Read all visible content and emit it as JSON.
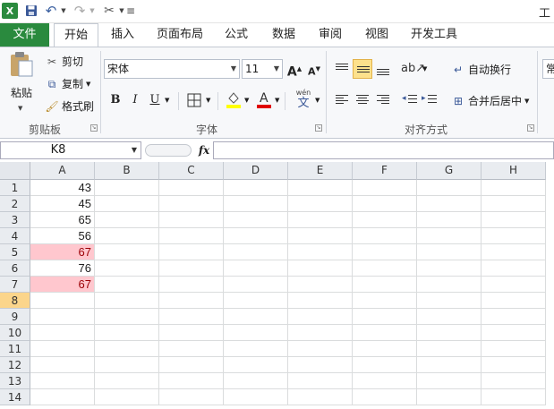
{
  "qat": {
    "undo_label": "↶",
    "redo_label": "↷",
    "title_partial": "工"
  },
  "tabs": [
    "文件",
    "开始",
    "插入",
    "页面布局",
    "公式",
    "数据",
    "审阅",
    "视图",
    "开发工具"
  ],
  "clipboard": {
    "paste": "粘贴",
    "cut": "剪切",
    "copy": "复制",
    "format_painter": "格式刷",
    "group": "剪贴板"
  },
  "font": {
    "name": "宋体",
    "size": "11",
    "grow": "A",
    "shrink": "A",
    "bold": "B",
    "italic": "I",
    "underline": "U",
    "font_color": "A",
    "phonetic": "wén",
    "phonetic_char": "文",
    "group": "字体"
  },
  "alignment": {
    "wrap_text": "自动换行",
    "merge_center": "合并后居中",
    "group": "对齐方式"
  },
  "number_format_partial": "常",
  "formula_bar": {
    "name_box": "K8",
    "fx": "fx",
    "content": ""
  },
  "grid": {
    "columns": [
      "A",
      "B",
      "C",
      "D",
      "E",
      "F",
      "G",
      "H"
    ],
    "rows": [
      "1",
      "2",
      "3",
      "4",
      "5",
      "6",
      "7",
      "8",
      "9",
      "10",
      "11",
      "12",
      "13",
      "14"
    ],
    "colA_values": [
      "43",
      "45",
      "65",
      "56",
      "67",
      "76",
      "67",
      "",
      "",
      "",
      "",
      "",
      "",
      ""
    ],
    "highlighted_rows": [
      5,
      7
    ],
    "selected_row": 8,
    "highlight_color": "#ffc7ce",
    "highlight_text_color": "#9c0006"
  },
  "colors": {
    "file_tab": "#2a8a3e",
    "ribbon_bg": "#f7f8fa",
    "header_bg": "#e9ecf0"
  }
}
